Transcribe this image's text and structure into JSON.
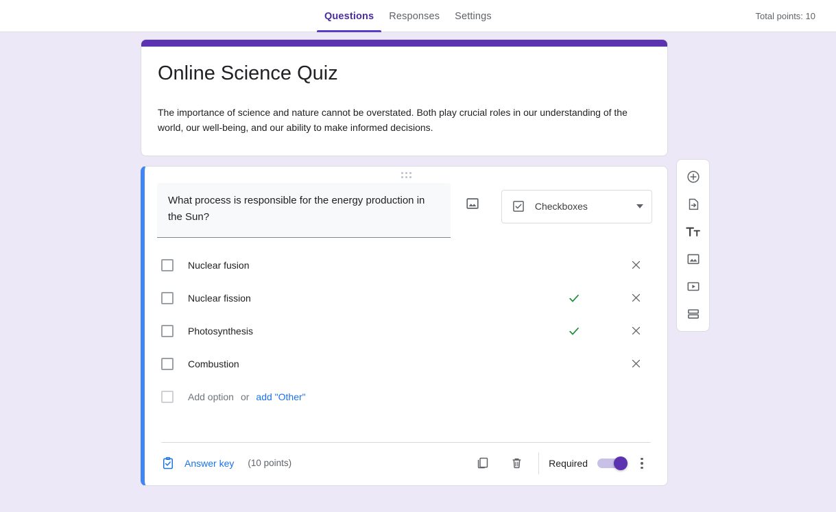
{
  "topbar": {
    "tabs": [
      {
        "label": "Questions",
        "active": true
      },
      {
        "label": "Responses",
        "active": false
      },
      {
        "label": "Settings",
        "active": false
      }
    ],
    "total_points": "Total points: 10"
  },
  "form_header": {
    "band_color": "#5b32b0",
    "title": "Online Science Quiz",
    "description": "The importance of science and nature cannot be overstated. Both play crucial roles in our understanding of the world, our well-being, and our ability to make informed decisions."
  },
  "question": {
    "accent_color": "#4285f4",
    "text": "What process is responsible for the energy production in the Sun?",
    "type_label": "Checkboxes",
    "options": [
      {
        "label": "Nuclear fusion",
        "correct": false
      },
      {
        "label": "Nuclear fission",
        "correct": true
      },
      {
        "label": "Photosynthesis",
        "correct": true
      },
      {
        "label": "Combustion",
        "correct": false
      }
    ],
    "add_option_label": "Add option",
    "or_label": "or",
    "add_other_label": "add \"Other\"",
    "correct_color": "#1e8e3e"
  },
  "footer": {
    "answer_key_label": "Answer key",
    "points_label": "(10 points)",
    "required_label": "Required",
    "required_on": true,
    "toggle_color": "#5b32b0",
    "link_color": "#1a73e8"
  },
  "side_toolbar": {
    "buttons": [
      {
        "name": "add-question-icon"
      },
      {
        "name": "import-questions-icon"
      },
      {
        "name": "add-title-description-icon"
      },
      {
        "name": "add-image-icon"
      },
      {
        "name": "add-video-icon"
      },
      {
        "name": "add-section-icon"
      }
    ]
  }
}
